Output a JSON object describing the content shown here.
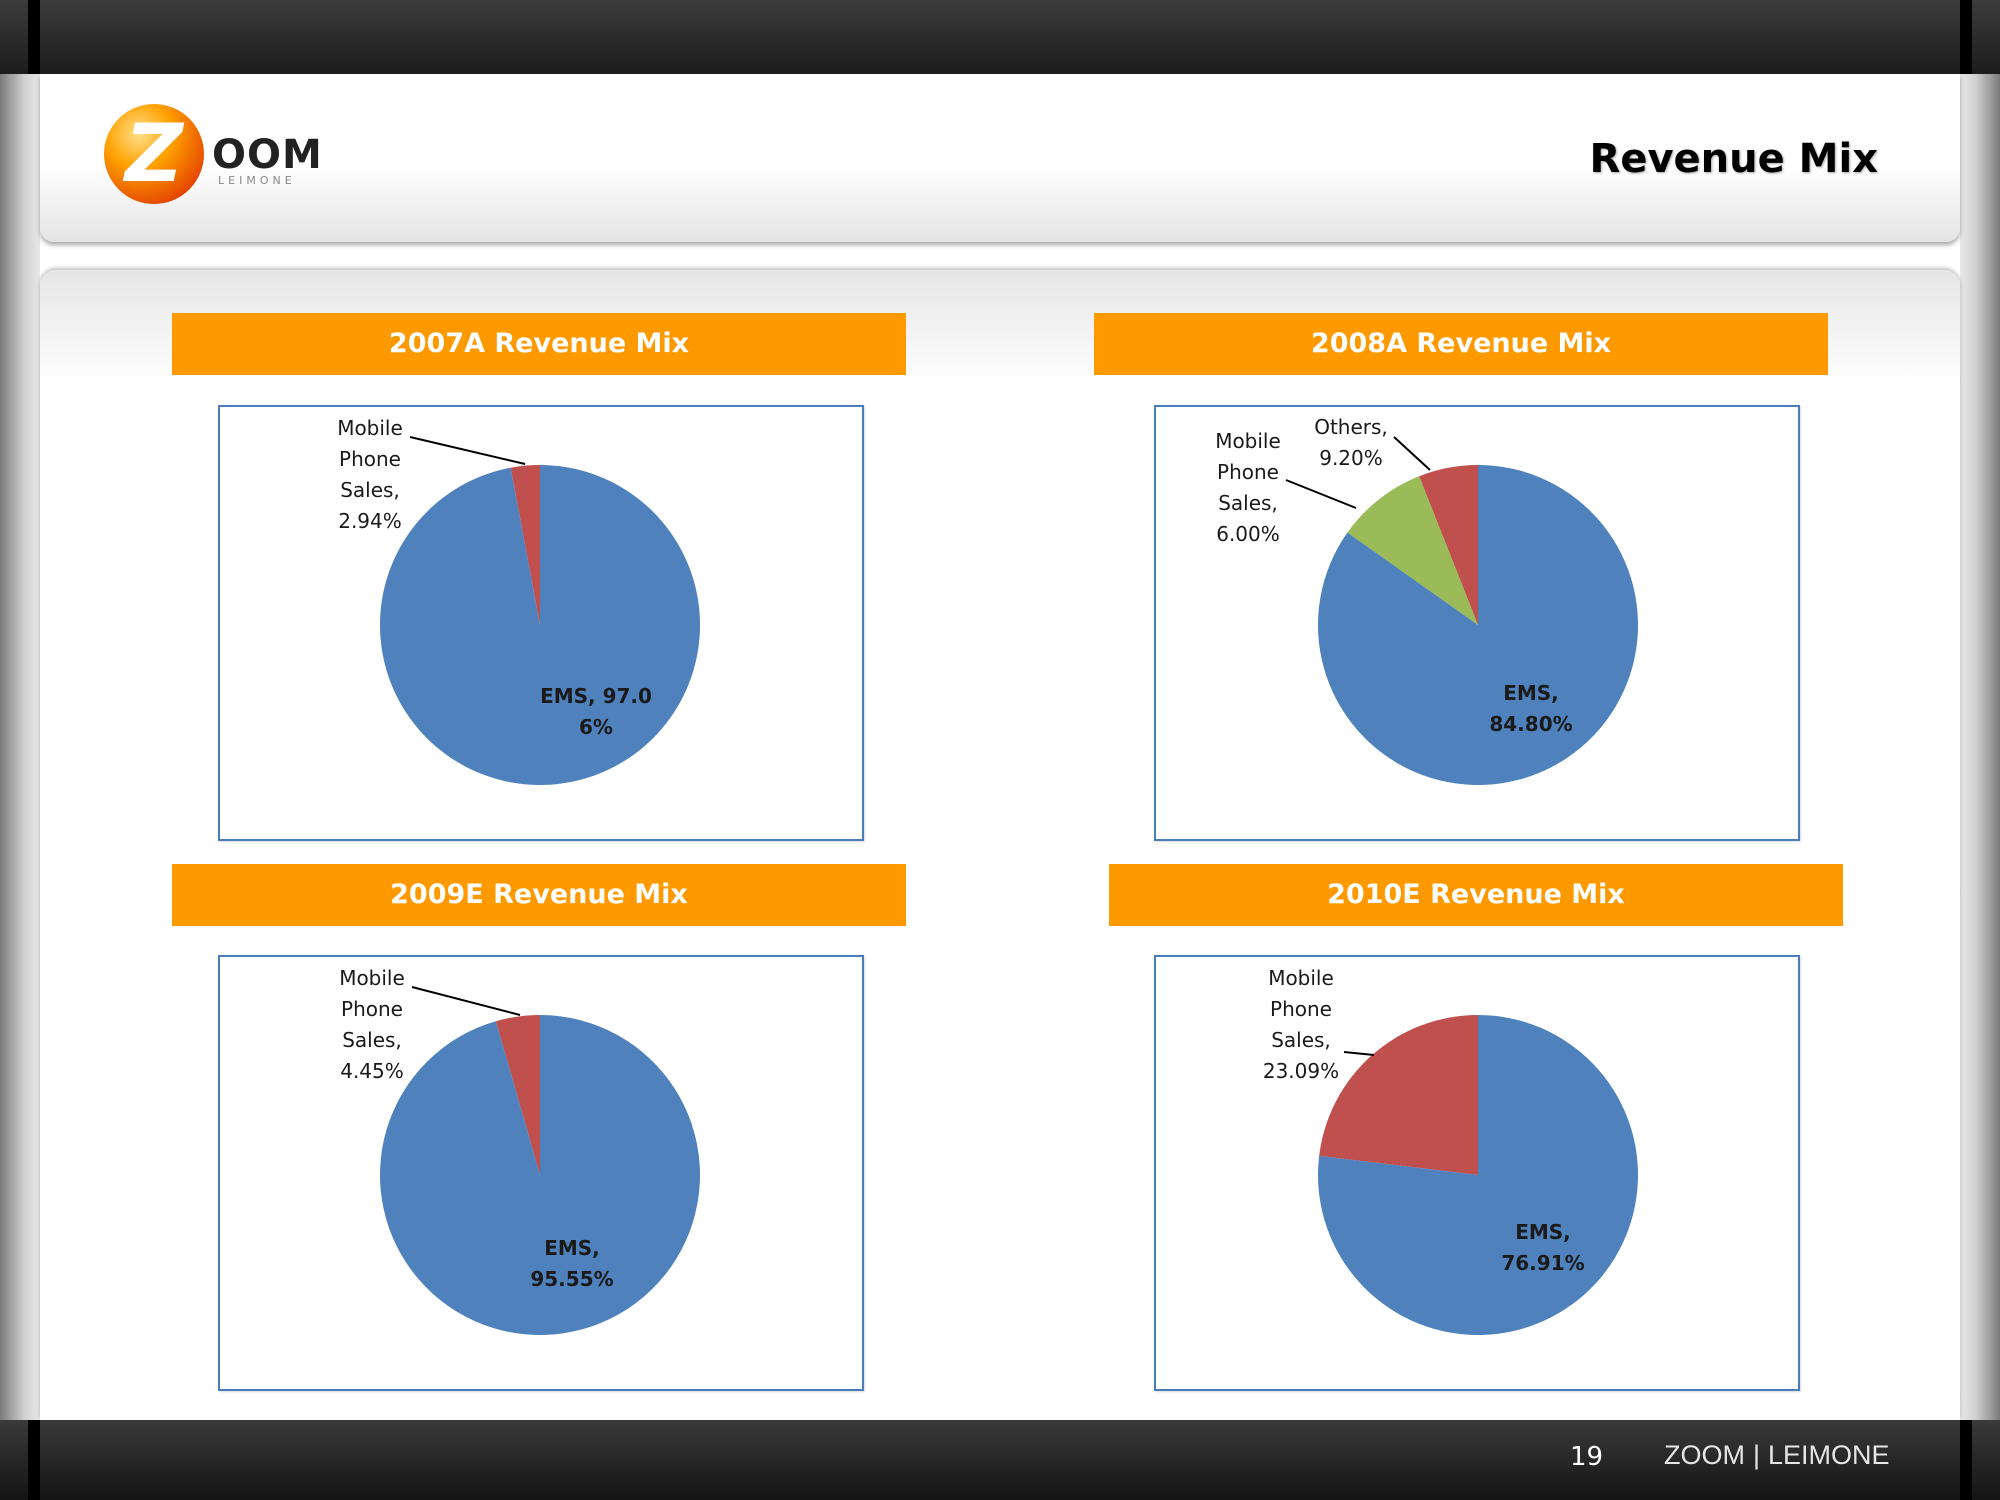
{
  "header": {
    "logo_text": "OOM",
    "logo_subtext": "LEIMONE",
    "logo_letter": "Z",
    "title": "Revenue Mix"
  },
  "footer": {
    "page_number": "19",
    "brand_left": "ZOOM",
    "brand_separator": "|",
    "brand_right": "LEIMONE"
  },
  "colors": {
    "banner": "#ff9900",
    "ems": "#4f81bd",
    "mobile": "#c0504d",
    "others": "#9bbb59",
    "chart_border": "#4a7ebb"
  },
  "chart_data": [
    {
      "type": "pie",
      "title": "2007A Revenue Mix",
      "slices": [
        {
          "name": "EMS",
          "value": 97.06,
          "label_lines": [
            "EMS, 97.0",
            "6%"
          ]
        },
        {
          "name": "Mobile Phone Sales",
          "value": 2.94,
          "label_lines": [
            "Mobile",
            "Phone",
            "Sales,",
            "2.94%"
          ]
        }
      ]
    },
    {
      "type": "pie",
      "title": "2008A Revenue Mix",
      "slices": [
        {
          "name": "EMS",
          "value": 84.8,
          "label_lines": [
            "EMS,",
            "84.80%"
          ]
        },
        {
          "name": "Mobile Phone Sales",
          "value": 6.0,
          "label_lines": [
            "Mobile",
            "Phone",
            "Sales,",
            "6.00%"
          ]
        },
        {
          "name": "Others",
          "value": 9.2,
          "label_lines": [
            "Others,",
            "9.20%"
          ]
        }
      ]
    },
    {
      "type": "pie",
      "title": "2009E Revenue Mix",
      "slices": [
        {
          "name": "EMS",
          "value": 95.55,
          "label_lines": [
            "EMS,",
            "95.55%"
          ]
        },
        {
          "name": "Mobile Phone Sales",
          "value": 4.45,
          "label_lines": [
            "Mobile",
            "Phone",
            "Sales,",
            "4.45%"
          ]
        }
      ]
    },
    {
      "type": "pie",
      "title": "2010E Revenue Mix",
      "slices": [
        {
          "name": "EMS",
          "value": 76.91,
          "label_lines": [
            "EMS,",
            "76.91%"
          ]
        },
        {
          "name": "Mobile Phone Sales",
          "value": 23.09,
          "label_lines": [
            "Mobile",
            "Phone",
            "Sales,",
            "23.09%"
          ]
        }
      ]
    }
  ]
}
